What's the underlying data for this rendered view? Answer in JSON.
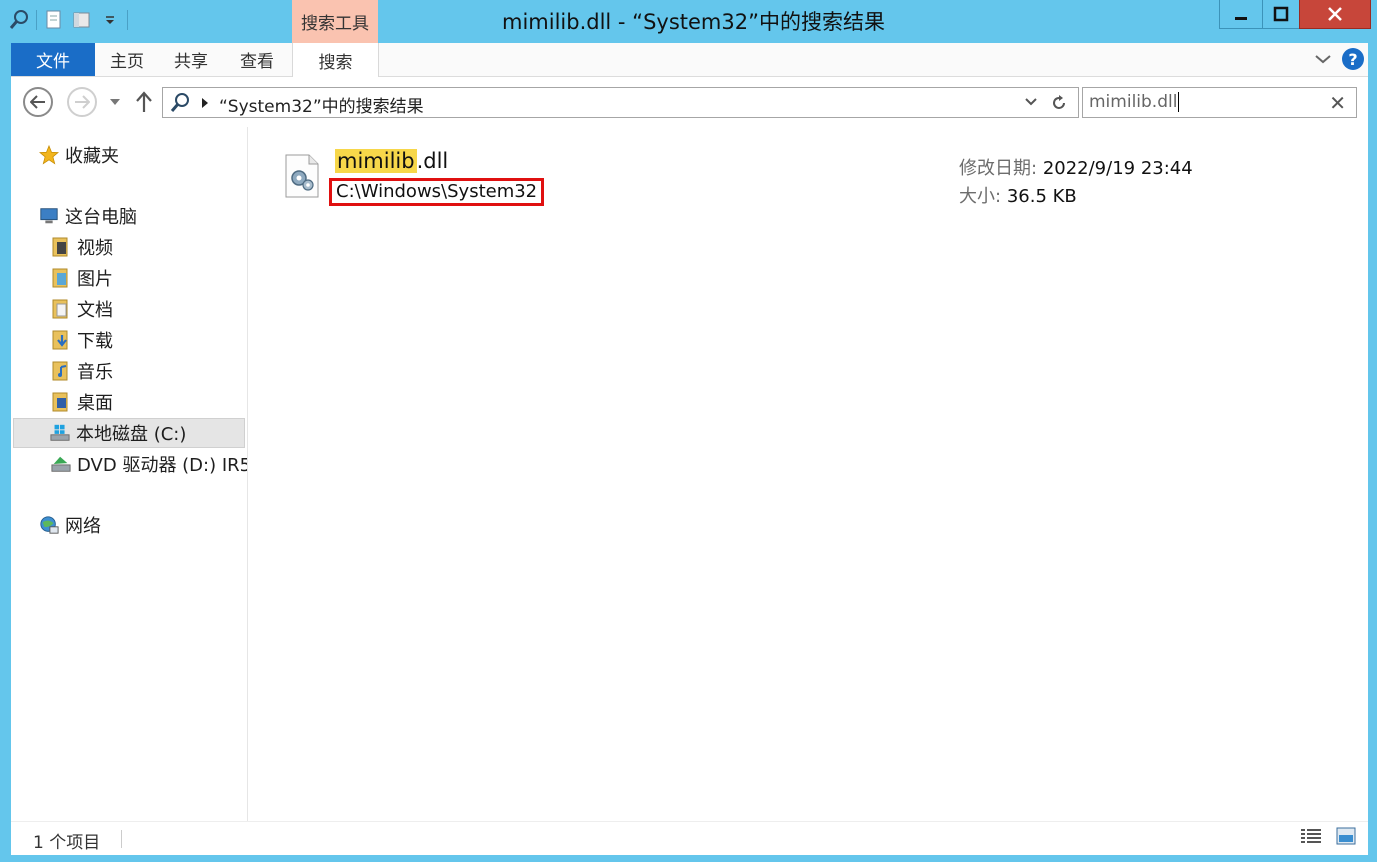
{
  "window": {
    "title": "mimilib.dll - “System32”中的搜索结果",
    "contextual_tab": "搜索工具"
  },
  "ribbon": {
    "tabs": [
      {
        "label": "文件"
      },
      {
        "label": "主页"
      },
      {
        "label": "共享"
      },
      {
        "label": "查看"
      },
      {
        "label": "搜索"
      }
    ]
  },
  "address_bar": {
    "path": "“System32”中的搜索结果"
  },
  "search": {
    "value": "mimilib.dll"
  },
  "nav_pane": {
    "favorites": "收藏夹",
    "this_pc": "这台电脑",
    "items": [
      {
        "label": "视频",
        "icon": "video-folder-icon"
      },
      {
        "label": "图片",
        "icon": "pictures-folder-icon"
      },
      {
        "label": "文档",
        "icon": "documents-folder-icon"
      },
      {
        "label": "下载",
        "icon": "downloads-folder-icon"
      },
      {
        "label": "音乐",
        "icon": "music-folder-icon"
      },
      {
        "label": "桌面",
        "icon": "desktop-folder-icon"
      },
      {
        "label": "本地磁盘 (C:)",
        "icon": "local-disk-icon",
        "selected": true
      },
      {
        "label": "DVD 驱动器 (D:) IR5",
        "icon": "dvd-drive-icon"
      }
    ],
    "network": "网络"
  },
  "result": {
    "name_highlight": "mimilib",
    "name_rest": ".dll",
    "path": "C:\\Windows\\System32",
    "modified_label": "修改日期:",
    "modified_value": "2022/9/19 23:44",
    "size_label": "大小:",
    "size_value": "36.5 KB"
  },
  "status": {
    "count": "1 个项目"
  },
  "colors": {
    "frame": "#64c6ec",
    "file_tab": "#1a6dc7",
    "contextual_tab": "#fac3b0",
    "close_button": "#c7463a",
    "highlight": "#f7d74a",
    "annotation_box": "#e01010"
  }
}
